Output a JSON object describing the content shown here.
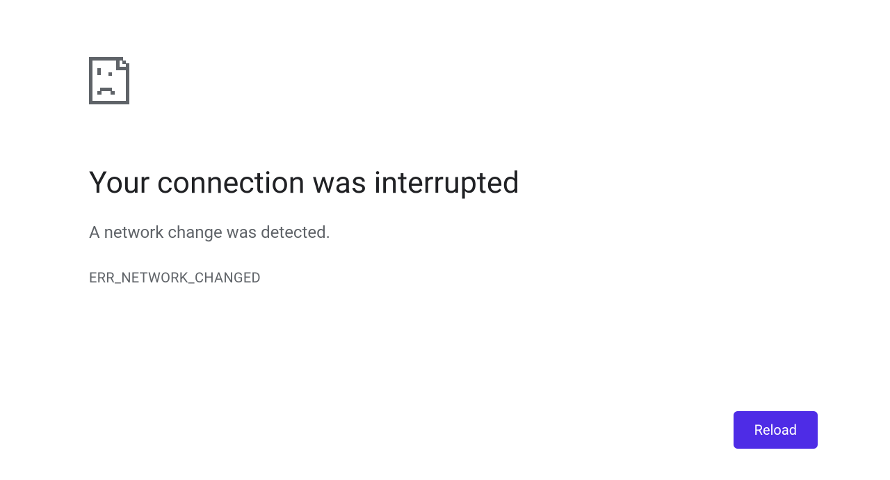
{
  "error": {
    "heading": "Your connection was interrupted",
    "subtext": "A network change was detected.",
    "code": "ERR_NETWORK_CHANGED"
  },
  "actions": {
    "reload_label": "Reload"
  },
  "colors": {
    "accent": "#4e2ce6",
    "text_primary": "#202124",
    "text_secondary": "#5f6368"
  }
}
